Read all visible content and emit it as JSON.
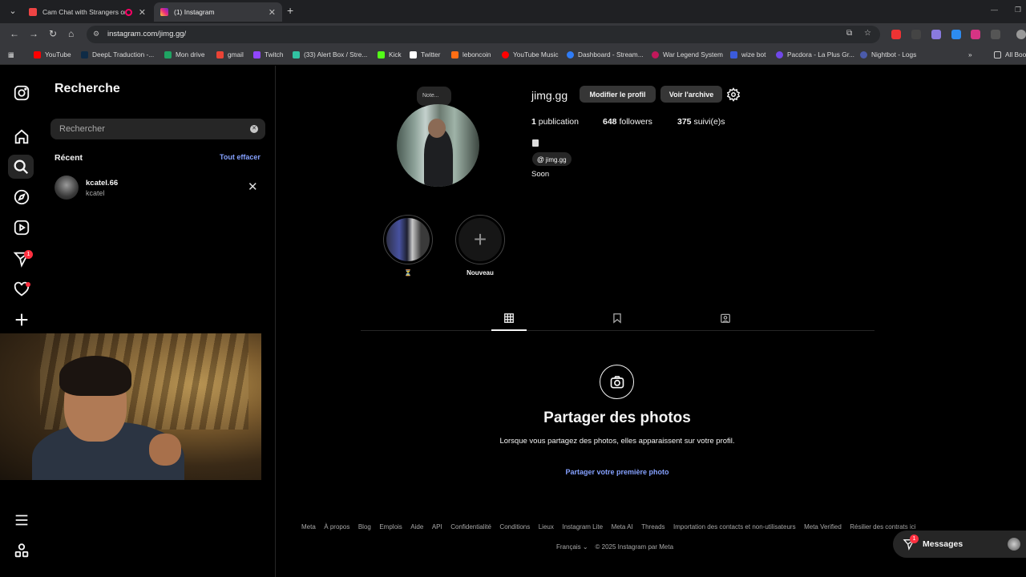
{
  "browser": {
    "tabs": [
      {
        "title": "Cam Chat with Strangers or",
        "active": false
      },
      {
        "title": "(1) Instagram",
        "active": true
      }
    ],
    "url": "instagram.com/jimg.gg/",
    "bookmarks": [
      "YouTube",
      "DeepL Traduction -...",
      "Mon drive",
      "gmail",
      "Twitch",
      "(33) Alert Box / Stre...",
      "Kick",
      "Twitter",
      "leboncoin",
      "YouTube Music",
      "Dashboard - Stream...",
      "War Legend System",
      "wize bot",
      "Pacdora - La Plus Gr...",
      "Nightbot - Logs"
    ],
    "all_bookmarks": "All Boo"
  },
  "search_panel": {
    "title": "Recherche",
    "placeholder": "Rechercher",
    "recent_label": "Récent",
    "clear_all": "Tout effacer",
    "recent": [
      {
        "username": "kcatel.66",
        "name": "kcatel"
      }
    ]
  },
  "nav": {
    "direct_badge": "1"
  },
  "profile": {
    "note": "Note...",
    "username": "jimg.gg",
    "edit_button": "Modifier le profil",
    "archive_button": "Voir l'archive",
    "posts_count": "1",
    "posts_label": "publication",
    "followers_count": "648",
    "followers_label": "followers",
    "following_count": "375",
    "following_label": "suivi(e)s",
    "threads_handle": "jimg.gg",
    "bio": "Soon",
    "highlights": [
      {
        "label": "⏳"
      },
      {
        "label": "Nouveau"
      }
    ]
  },
  "empty_state": {
    "title": "Partager des photos",
    "description": "Lorsque vous partagez des photos, elles apparaissent sur votre profil.",
    "link": "Partager votre première photo"
  },
  "footer": {
    "links": [
      "Meta",
      "À propos",
      "Blog",
      "Emplois",
      "Aide",
      "API",
      "Confidentialité",
      "Conditions",
      "Lieux",
      "Instagram Lite",
      "Meta AI",
      "Threads",
      "Importation des contacts et non-utilisateurs",
      "Meta Verified",
      "Résilier des contrats ici"
    ],
    "language": "Français",
    "copyright": "© 2025 Instagram par Meta"
  },
  "messages": {
    "label": "Messages",
    "badge": "1"
  },
  "colors": {
    "link_blue": "#85a1ff",
    "notification_red": "#ff3040",
    "surface": "#262626"
  }
}
